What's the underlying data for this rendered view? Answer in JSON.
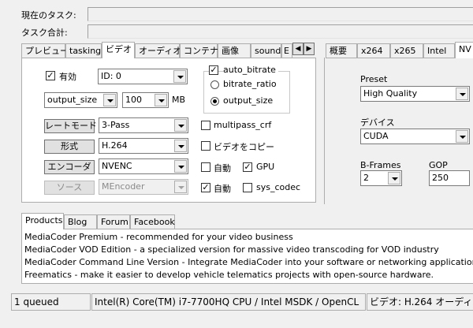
{
  "header": {
    "current_task_label": "現在のタスク:",
    "total_task_label": "タスク合計:"
  },
  "left_tabs": [
    "プレビュー",
    "tasking",
    "ビデオ",
    "オーディオ",
    "コンテナ",
    "画像",
    "sound",
    "E"
  ],
  "right_tabs": [
    "概要",
    "x264",
    "x265",
    "Intel",
    "NV"
  ],
  "video": {
    "enabled_label": "有効",
    "enabled_checked": true,
    "id_value": "ID: 0",
    "size_mode": "output_size",
    "size_value": "100",
    "size_unit": "MB",
    "bitrate_options": [
      {
        "label": "auto_bitrate",
        "checked": true
      },
      {
        "label": "bitrate_ratio",
        "checked": false
      },
      {
        "label": "output_size",
        "checked": true
      }
    ],
    "rate_mode_button": "レートモード",
    "rate_mode_value": "3-Pass",
    "format_button": "形式",
    "format_value": "H.264",
    "encoder_button": "エンコーダ",
    "encoder_value": "NVENC",
    "source_button": "ソース",
    "source_value": "MEncoder",
    "multipass_crf_label": "multipass_crf",
    "copy_video_label": "ビデオをコピー",
    "auto1_label": "自動",
    "gpu_label": "GPU",
    "auto2_label": "自動",
    "sys_codec_label": "sys_codec"
  },
  "nvenc": {
    "preset_label": "Preset",
    "preset_value": "High Quality",
    "device_label": "デバイス",
    "device_value": "CUDA",
    "bframes_label": "B-Frames",
    "bframes_value": "2",
    "gop_label": "GOP",
    "gop_value": "250"
  },
  "bottom_tabs": [
    "Products",
    "Blog",
    "Forum",
    "Facebook"
  ],
  "products": [
    "MediaCoder Premium - recommended for your video business",
    "MediaCoder VOD Edition - a specialized version for massive video transcoding for VOD industry",
    "MediaCoder Command Line Version - Integrate MediaCoder into your software or networking application",
    "Freematics - make it easier to develop vehicle telematics projects with open-source hardware."
  ],
  "status_bar": {
    "queue": "1 queued",
    "cpu": "Intel(R) Core(TM) i7-7700HQ CPU  /  Intel MSDK / OpenCL",
    "video_info": "ビデオ: H.264  オーディ"
  }
}
